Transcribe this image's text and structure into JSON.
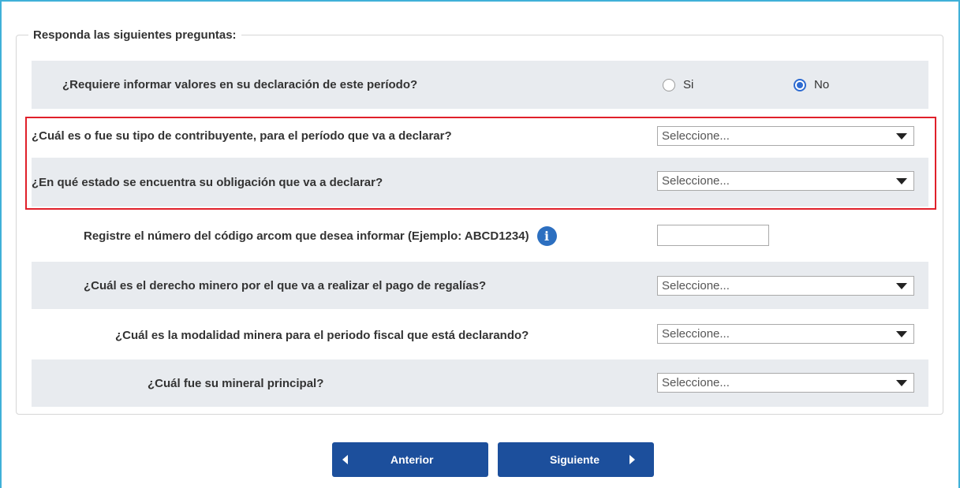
{
  "form": {
    "legend": "Responda las siguientes preguntas:",
    "questions": [
      {
        "label": "¿Requiere informar valores en su declaración de este período?",
        "options": [
          {
            "label": "Si",
            "checked": false
          },
          {
            "label": "No",
            "checked": true
          }
        ]
      },
      {
        "label": "¿Cuál es o fue su tipo de contribuyente, para el período que va a declarar?",
        "selected": "Seleccione..."
      },
      {
        "label": "¿En qué estado se encuentra su obligación que va a declarar?",
        "selected": "Seleccione..."
      },
      {
        "label": "Registre el número del código arcom que desea informar (Ejemplo: ABCD1234)",
        "value": ""
      },
      {
        "label": "¿Cuál es el derecho minero por el que va a realizar el pago de regalías?",
        "selected": "Seleccione..."
      },
      {
        "label": "¿Cuál es la modalidad minera para el periodo fiscal que está declarando?",
        "selected": "Seleccione..."
      },
      {
        "label": "¿Cuál fue su mineral principal?",
        "selected": "Seleccione..."
      }
    ]
  },
  "info_icon": {
    "symbol": "i"
  },
  "buttons": {
    "previous": "Anterior",
    "next": "Siguiente"
  },
  "colors": {
    "accent_frame": "#3fb0d8",
    "row_shade": "#e8ebef",
    "highlight": "#e0202a",
    "button": "#1c4f9c",
    "radio": "#2e6bd1"
  }
}
